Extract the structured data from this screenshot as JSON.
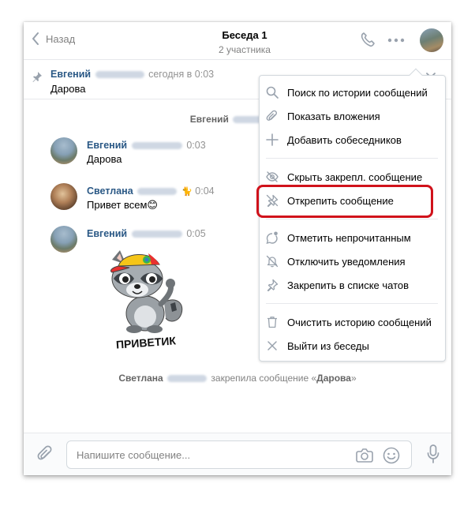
{
  "header": {
    "back_label": "Назад",
    "title": "Беседа 1",
    "subtitle": "2 участника"
  },
  "pinned": {
    "author": "Евгений",
    "time": "сегодня в 0:03",
    "text": "Дарова"
  },
  "service_top": {
    "author": "Евгений"
  },
  "messages": [
    {
      "author": "Евгений",
      "time": "0:03",
      "text": "Дарова"
    },
    {
      "author": "Светлана",
      "emoji": "🐈",
      "time": "0:04",
      "text": "Привет всем😊"
    },
    {
      "author": "Евгений",
      "time": "0:05"
    }
  ],
  "sticker": {
    "caption": "ПРИВЕТИК"
  },
  "service_bottom": {
    "author": "Светлана",
    "action": "закрепила сообщение «",
    "pinned_text": "Дарова",
    "tail": "»"
  },
  "composer": {
    "placeholder": "Напишите сообщение..."
  },
  "menu": {
    "items": [
      {
        "label": "Поиск по истории сообщений",
        "icon": "search-icon"
      },
      {
        "label": "Показать вложения",
        "icon": "paperclip-icon"
      },
      {
        "label": "Добавить собеседников",
        "icon": "plus-icon"
      },
      {
        "label": "Скрыть закрепл. сообщение",
        "icon": "eye-off-icon"
      },
      {
        "label": "Открепить сообщение",
        "icon": "unpin-icon"
      },
      {
        "label": "Отметить непрочитанным",
        "icon": "unread-icon"
      },
      {
        "label": "Отключить уведомления",
        "icon": "bell-off-icon"
      },
      {
        "label": "Закрепить в списке чатов",
        "icon": "pin-icon"
      },
      {
        "label": "Очистить историю сообщений",
        "icon": "trash-icon"
      },
      {
        "label": "Выйти из беседы",
        "icon": "close-icon"
      }
    ]
  },
  "colors": {
    "link": "#2a5885",
    "icon": "#99a2ad",
    "highlight": "#d0121b"
  }
}
